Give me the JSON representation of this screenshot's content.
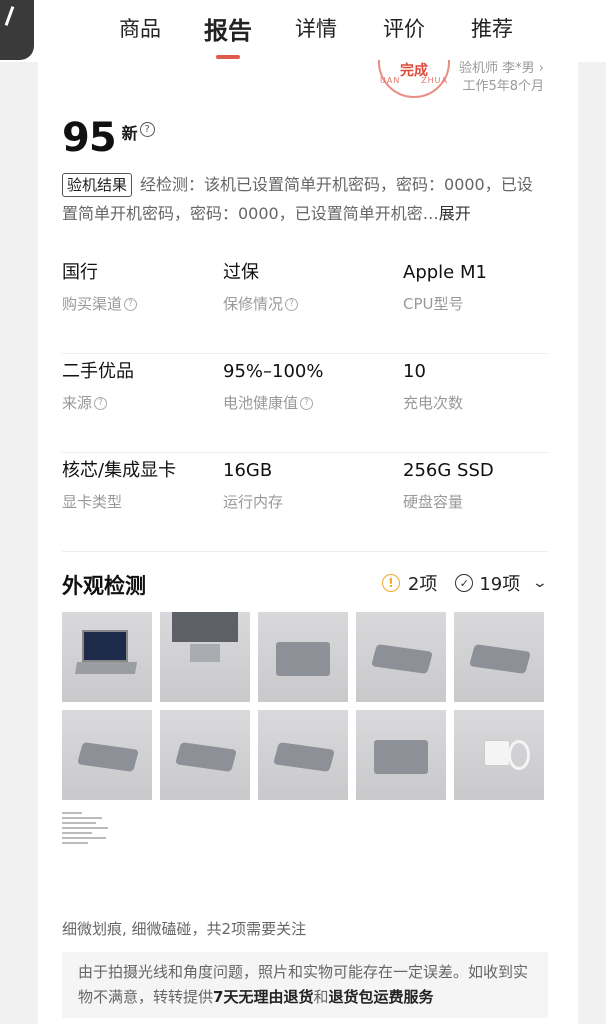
{
  "tabs": [
    {
      "label": "商品",
      "active": false
    },
    {
      "label": "报告",
      "active": true
    },
    {
      "label": "详情",
      "active": false
    },
    {
      "label": "评价",
      "active": false
    },
    {
      "label": "推荐",
      "active": false
    }
  ],
  "inspector": {
    "stamp_text": "完成",
    "stamp_arc": [
      "UAN",
      "ZHUA"
    ],
    "name": "验机师 李*男",
    "tenure": "工作5年8个月"
  },
  "score": {
    "value": "95",
    "suffix": "新"
  },
  "result": {
    "tag": "验机结果",
    "text": "经检测：该机已设置简单开机密码，密码：0000，已设置简单开机密码，密码：0000，已设置简单开机密…",
    "expand": "展开"
  },
  "specs": [
    [
      {
        "value": "国行",
        "label": "购买渠道",
        "help": true
      },
      {
        "value": "过保",
        "label": "保修情况",
        "help": true
      },
      {
        "value": "Apple M1",
        "label": "CPU型号",
        "help": false
      }
    ],
    [
      {
        "value": "二手优品",
        "label": "来源",
        "help": true
      },
      {
        "value": "95%–100%",
        "label": "电池健康值",
        "help": true
      },
      {
        "value": "10",
        "label": "充电次数",
        "help": false
      }
    ],
    [
      {
        "value": "核芯/集成显卡",
        "label": "显卡类型",
        "help": false
      },
      {
        "value": "16GB",
        "label": "运行内存",
        "help": false
      },
      {
        "value": "256G SSD",
        "label": "硬盘容量",
        "help": false
      }
    ]
  ],
  "exterior": {
    "title": "外观检测",
    "warn_count": "2项",
    "ok_count": "19项"
  },
  "photos": [
    "open",
    "keyboard",
    "top",
    "laptop",
    "laptop",
    "laptop",
    "laptop",
    "laptop",
    "bottom",
    "charger"
  ],
  "notice": "细微划痕, 细微磕碰，共2项需要关注",
  "disclaimer": {
    "pre": "由于拍摄光线和角度问题，照片和实物可能存在一定误差。如收到实物不满意，转转提供",
    "bold1": "7天无理由退货",
    "mid": "和",
    "bold2": "退货包运费服务"
  },
  "icons": {
    "help": "question-circle-icon",
    "warn": "exclamation-circle-icon",
    "ok": "check-circle-icon",
    "chevron": "chevron-down-icon"
  },
  "colors": {
    "accent": "#e05a4a",
    "warn": "#f0a82c"
  }
}
